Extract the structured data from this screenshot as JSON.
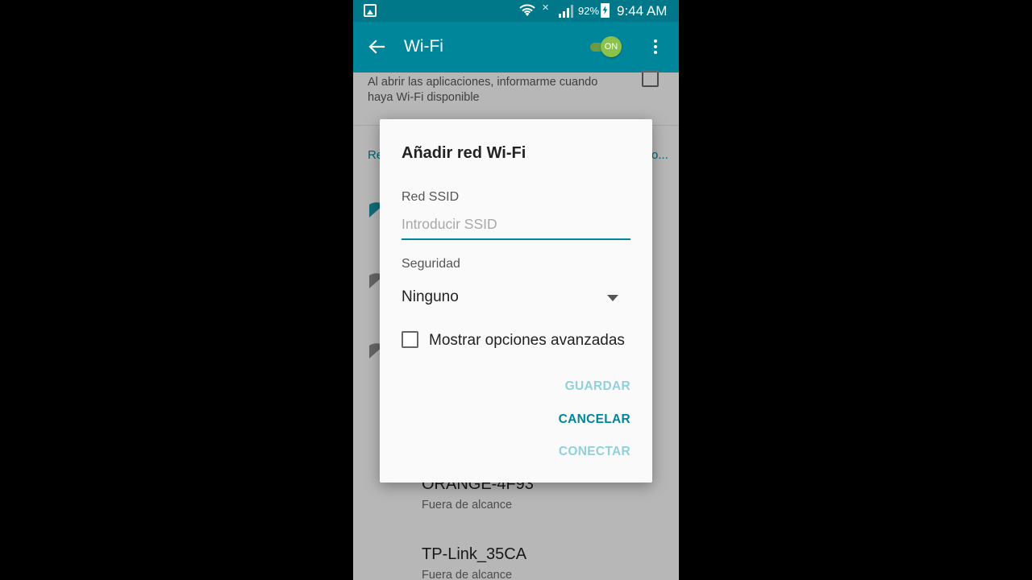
{
  "status_bar": {
    "battery_percent": "92%",
    "time": "9:44 AM",
    "icons": [
      "image-icon",
      "wifi-icon",
      "mute-icon",
      "signal-icon",
      "battery-charging-icon"
    ]
  },
  "app_bar": {
    "title": "Wi-Fi",
    "toggle_label": "ON",
    "colors": {
      "primary": "#00869a",
      "status": "#00788a",
      "toggle_on": "#8bc34a"
    }
  },
  "background": {
    "notify_text": "Al abrir las aplicaciones, informarme cuando haya Wi-Fi disponible",
    "section_header_left": "Re",
    "section_header_right": "o...",
    "networks": [
      {
        "name": "ORANGE-4F93",
        "status": "Fuera de alcance"
      },
      {
        "name": "TP-Link_35CA",
        "status": "Fuera de alcance"
      }
    ]
  },
  "dialog": {
    "title": "Añadir red Wi-Fi",
    "ssid_label": "Red SSID",
    "ssid_placeholder": "Introducir SSID",
    "ssid_value": "",
    "security_label": "Seguridad",
    "security_value": "Ninguno",
    "advanced_label": "Mostrar opciones avanzadas",
    "advanced_checked": false,
    "buttons": {
      "save": "GUARDAR",
      "cancel": "CANCELAR",
      "connect": "CONECTAR"
    }
  }
}
